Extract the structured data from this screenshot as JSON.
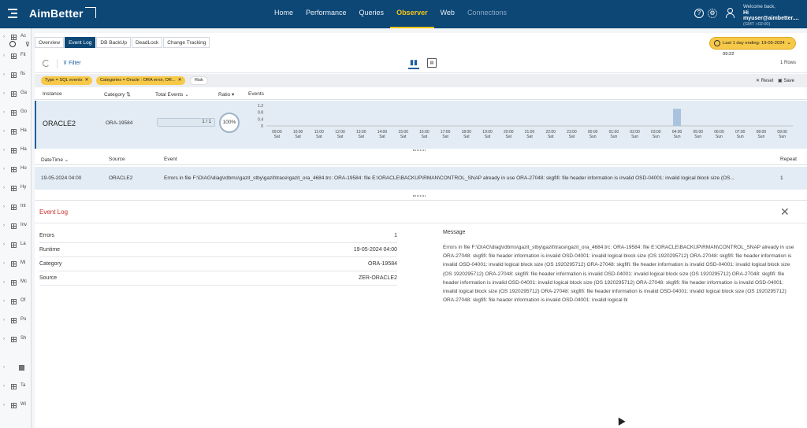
{
  "app": {
    "name": "AimBetter"
  },
  "nav": [
    {
      "label": "Home",
      "state": "normal"
    },
    {
      "label": "Performance",
      "state": "normal"
    },
    {
      "label": "Queries",
      "state": "normal"
    },
    {
      "label": "Observer",
      "state": "active"
    },
    {
      "label": "Web",
      "state": "normal"
    },
    {
      "label": "Connections",
      "state": "dim"
    }
  ],
  "header": {
    "help_icon": "question-circle-icon",
    "settings_icon": "gear-icon",
    "welcome": "Welcome back,",
    "user": "Hi myuser@aimbetter....",
    "gmt": "(GMT +02:00)"
  },
  "sidebar": {
    "items": [
      {
        "label": "Ac"
      },
      {
        "label": "Fit"
      },
      {
        "label": "fis"
      },
      {
        "label": "Ga"
      },
      {
        "label": "Go"
      },
      {
        "label": "Ha"
      },
      {
        "label": "Ha"
      },
      {
        "label": "Ho"
      },
      {
        "label": "Hy"
      },
      {
        "label": "Int"
      },
      {
        "label": "Inv"
      },
      {
        "label": "La"
      },
      {
        "label": "Mi"
      },
      {
        "label": "Mc"
      },
      {
        "label": "Of"
      },
      {
        "label": "Po"
      },
      {
        "label": "Sh"
      },
      {
        "label": ""
      },
      {
        "label": "Ta"
      },
      {
        "label": "Wi"
      }
    ]
  },
  "tabs": [
    {
      "label": "Overview",
      "active": false
    },
    {
      "label": "Event Log",
      "active": true
    },
    {
      "label": "DB BackUp",
      "active": false
    },
    {
      "label": "DeadLock",
      "active": false
    },
    {
      "label": "Change Tracking",
      "active": false
    }
  ],
  "time_range": "Last 1 day ending: 19-05-2024 09:22",
  "toolbar": {
    "filter_label": "Filter",
    "rows": "1 Rows"
  },
  "chips": [
    {
      "label": "Type = SQL events"
    },
    {
      "label": "Categories = Oracle : ORA error, OR..."
    },
    {
      "label": "Risk"
    }
  ],
  "actions": {
    "reset": "Reset",
    "save": "Save"
  },
  "instances_table": {
    "columns": [
      "Instance",
      "Category",
      "Total Events",
      "Ratio",
      "Events"
    ],
    "row": {
      "instance": "ORACLE2",
      "category": "ORA-19584",
      "total": "1 / 1",
      "total_fraction": 1.0,
      "ratio": "100%"
    }
  },
  "chart_data": {
    "type": "bar",
    "y_ticks": [
      "1.2",
      "0.8",
      "0.4",
      "0"
    ],
    "ylim": [
      0,
      1.2
    ],
    "categories": [
      {
        "time": "09:00",
        "day": "Sat"
      },
      {
        "time": "10:00",
        "day": "Sat"
      },
      {
        "time": "11:00",
        "day": "Sat"
      },
      {
        "time": "12:00",
        "day": "Sat"
      },
      {
        "time": "13:00",
        "day": "Sat"
      },
      {
        "time": "14:00",
        "day": "Sat"
      },
      {
        "time": "15:00",
        "day": "Sat"
      },
      {
        "time": "16:00",
        "day": "Sat"
      },
      {
        "time": "17:00",
        "day": "Sat"
      },
      {
        "time": "18:00",
        "day": "Sat"
      },
      {
        "time": "19:00",
        "day": "Sat"
      },
      {
        "time": "20:00",
        "day": "Sat"
      },
      {
        "time": "21:00",
        "day": "Sat"
      },
      {
        "time": "22:00",
        "day": "Sat"
      },
      {
        "time": "23:00",
        "day": "Sat"
      },
      {
        "time": "00:00",
        "day": "Sun"
      },
      {
        "time": "01:00",
        "day": "Sun"
      },
      {
        "time": "02:00",
        "day": "Sun"
      },
      {
        "time": "03:00",
        "day": "Sun"
      },
      {
        "time": "04:00",
        "day": "Sun"
      },
      {
        "time": "05:00",
        "day": "Sun"
      },
      {
        "time": "06:00",
        "day": "Sun"
      },
      {
        "time": "07:00",
        "day": "Sun"
      },
      {
        "time": "08:00",
        "day": "Sun"
      },
      {
        "time": "09:00",
        "day": "Sun"
      }
    ],
    "values": [
      0,
      0,
      0,
      0,
      0,
      0,
      0,
      0,
      0,
      0,
      0,
      0,
      0,
      0,
      0,
      0,
      0,
      0,
      0,
      1,
      0,
      0,
      0,
      0,
      0
    ]
  },
  "events_table": {
    "columns": [
      "DateTime",
      "Source",
      "Event",
      "Repeat"
    ],
    "row": {
      "datetime": "19-05-2024 04:00",
      "source": "ORACLE2",
      "event": "Errors in file F:\\DIAG\\diag\\rdbms\\gazit_stby\\gazit\\trace\\gazit_ora_4684.trc: ORA-19584: file E:\\ORACLE\\BACKUP\\RMAN\\CONTROL_SNAP already in use ORA-27048: skgfifi: file header information is invalid OSD-04001: invalid logical block size (OS...",
      "repeat": "1"
    }
  },
  "detail": {
    "title": "Event Log",
    "fields": [
      {
        "key": "Errors",
        "value": "1"
      },
      {
        "key": "Runtime",
        "value": "19-05-2024 04:00"
      },
      {
        "key": "Category",
        "value": "ORA-19584"
      },
      {
        "key": "Source",
        "value": "ZER-ORACLE2"
      }
    ],
    "message_label": "Message",
    "message": "Errors in file F:\\DIAG\\diag\\rdbms\\gazit_stby\\gazit\\trace\\gazit_ora_4684.trc: ORA-19584: file E:\\ORACLE\\BACKUP\\RMAN\\CONTROL_SNAP already in use ORA-27048: skgfifi: file header information is invalid OSD-04001: invalid logical block size (OS 1920295712) ORA-27048: skgfifi: file header information is invalid OSD-04001: invalid logical block size (OS 1920295712) ORA-27048: skgfifi: file header information is invalid OSD-04001: invalid logical block size (OS 1920295712) ORA-27048: skgfifi: file header information is invalid OSD-04001: invalid logical block size (OS 1920295712) ORA-27048: skgfifi: file header information is invalid OSD-04001: invalid logical block size (OS 1920295712) ORA-27048: skgfifi: file header information is invalid OSD-04001: invalid logical block size (OS 1920295712) ORA-27048: skgfifi: file header information is invalid OSD-04001: invalid logical block size (OS 1920295712) ORA-27048: skgfifi: file header information is invalid OSD-04001: invalid logical bl"
  }
}
